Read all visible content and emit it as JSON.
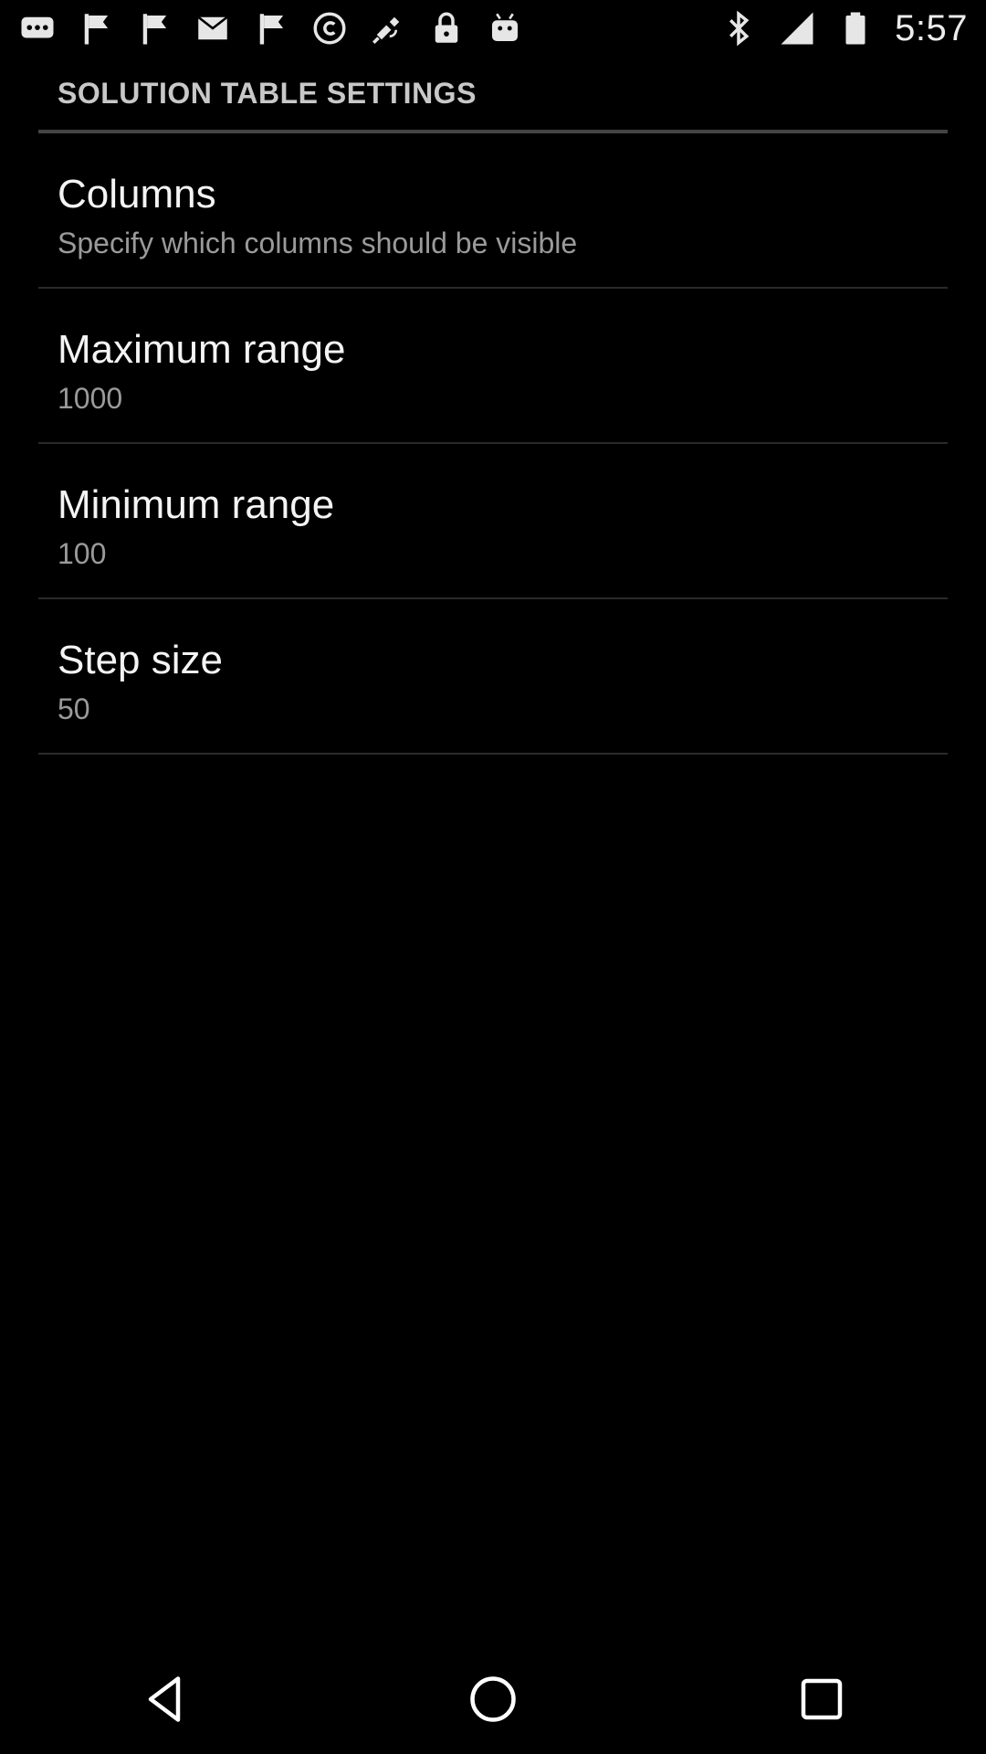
{
  "status_bar": {
    "time": "5:57",
    "left_icons": [
      "messages-icon",
      "flag-icon",
      "flag-icon",
      "mail-icon",
      "flag-icon",
      "copyright-icon",
      "fake-gps-satellite-icon",
      "lock-icon",
      "android-icon"
    ],
    "right_icons": [
      "bluetooth-icon",
      "signal-icon",
      "battery-icon"
    ]
  },
  "settings": {
    "section_title": "SOLUTION TABLE SETTINGS",
    "items": [
      {
        "title": "Columns",
        "summary": "Specify which columns should be visible"
      },
      {
        "title": "Maximum range",
        "summary": "1000"
      },
      {
        "title": "Minimum range",
        "summary": "100"
      },
      {
        "title": "Step size",
        "summary": "50"
      }
    ]
  },
  "nav_bar": {
    "buttons": [
      "back-icon",
      "home-icon",
      "recents-icon"
    ]
  },
  "colors": {
    "background": "#000000",
    "title_text": "#f4f4f4",
    "summary_text": "#9a9a9a",
    "header_text": "#c8c8c8"
  }
}
